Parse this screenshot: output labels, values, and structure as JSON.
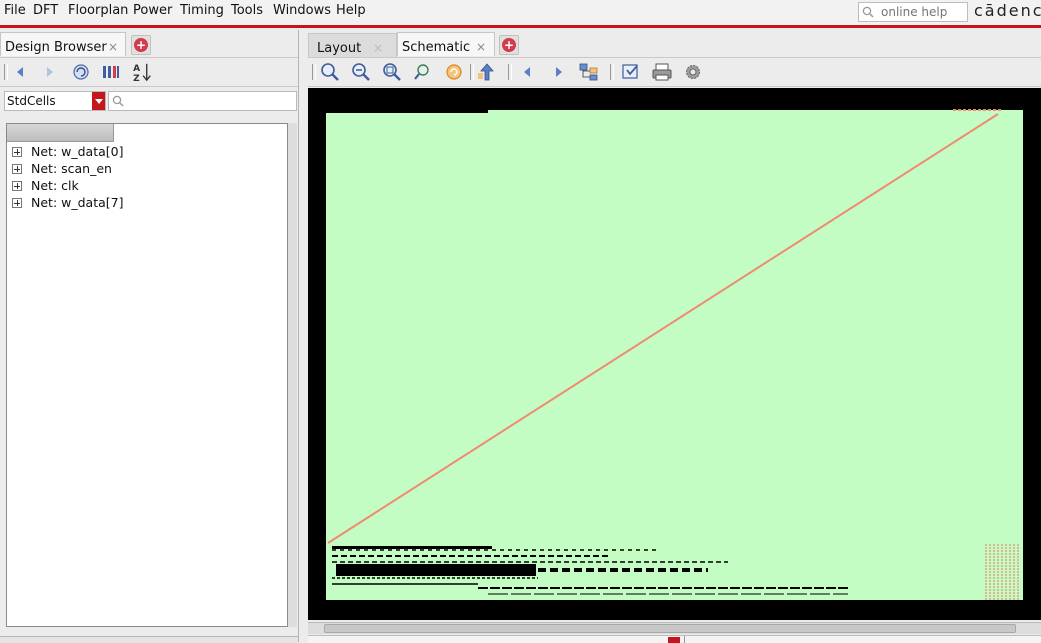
{
  "menubar": {
    "items": [
      "File",
      "DFT",
      "Floorplan",
      "Power",
      "Timing",
      "Tools",
      "Windows",
      "Help"
    ],
    "help_placeholder": "online help",
    "logo": "cādence"
  },
  "left_panel": {
    "tab_label": "Design Browser",
    "close_glyph": "×",
    "add_glyph": "+",
    "library_value": "StdCells",
    "tree_items": [
      {
        "label": "Net: w_data[0]"
      },
      {
        "label": "Net: scan_en"
      },
      {
        "label": "Net: clk"
      },
      {
        "label": "Net: w_data[7]"
      }
    ],
    "toolbar_icons": [
      "back-arrow-icon",
      "forward-arrow-icon",
      "refresh-icon",
      "filter-icon",
      "sort-az-icon"
    ]
  },
  "right_panel": {
    "tabs": [
      {
        "label": "Layout",
        "active": false
      },
      {
        "label": "Schematic",
        "active": true
      }
    ],
    "close_glyph": "×",
    "add_glyph": "+",
    "toolbar_icons": [
      "zoom-in-icon",
      "zoom-out-icon",
      "zoom-fit-icon",
      "zoom-previous-icon",
      "redraw-icon",
      "push-up-icon",
      "back-icon",
      "forward-icon",
      "hierarchy-icon",
      "select-icon",
      "print-icon",
      "settings-icon"
    ]
  },
  "colors": {
    "accent_red": "#c4161c",
    "canvas_bg": "#000000",
    "die_fill": "#c3fdc3",
    "net_color": "#f08a72"
  }
}
